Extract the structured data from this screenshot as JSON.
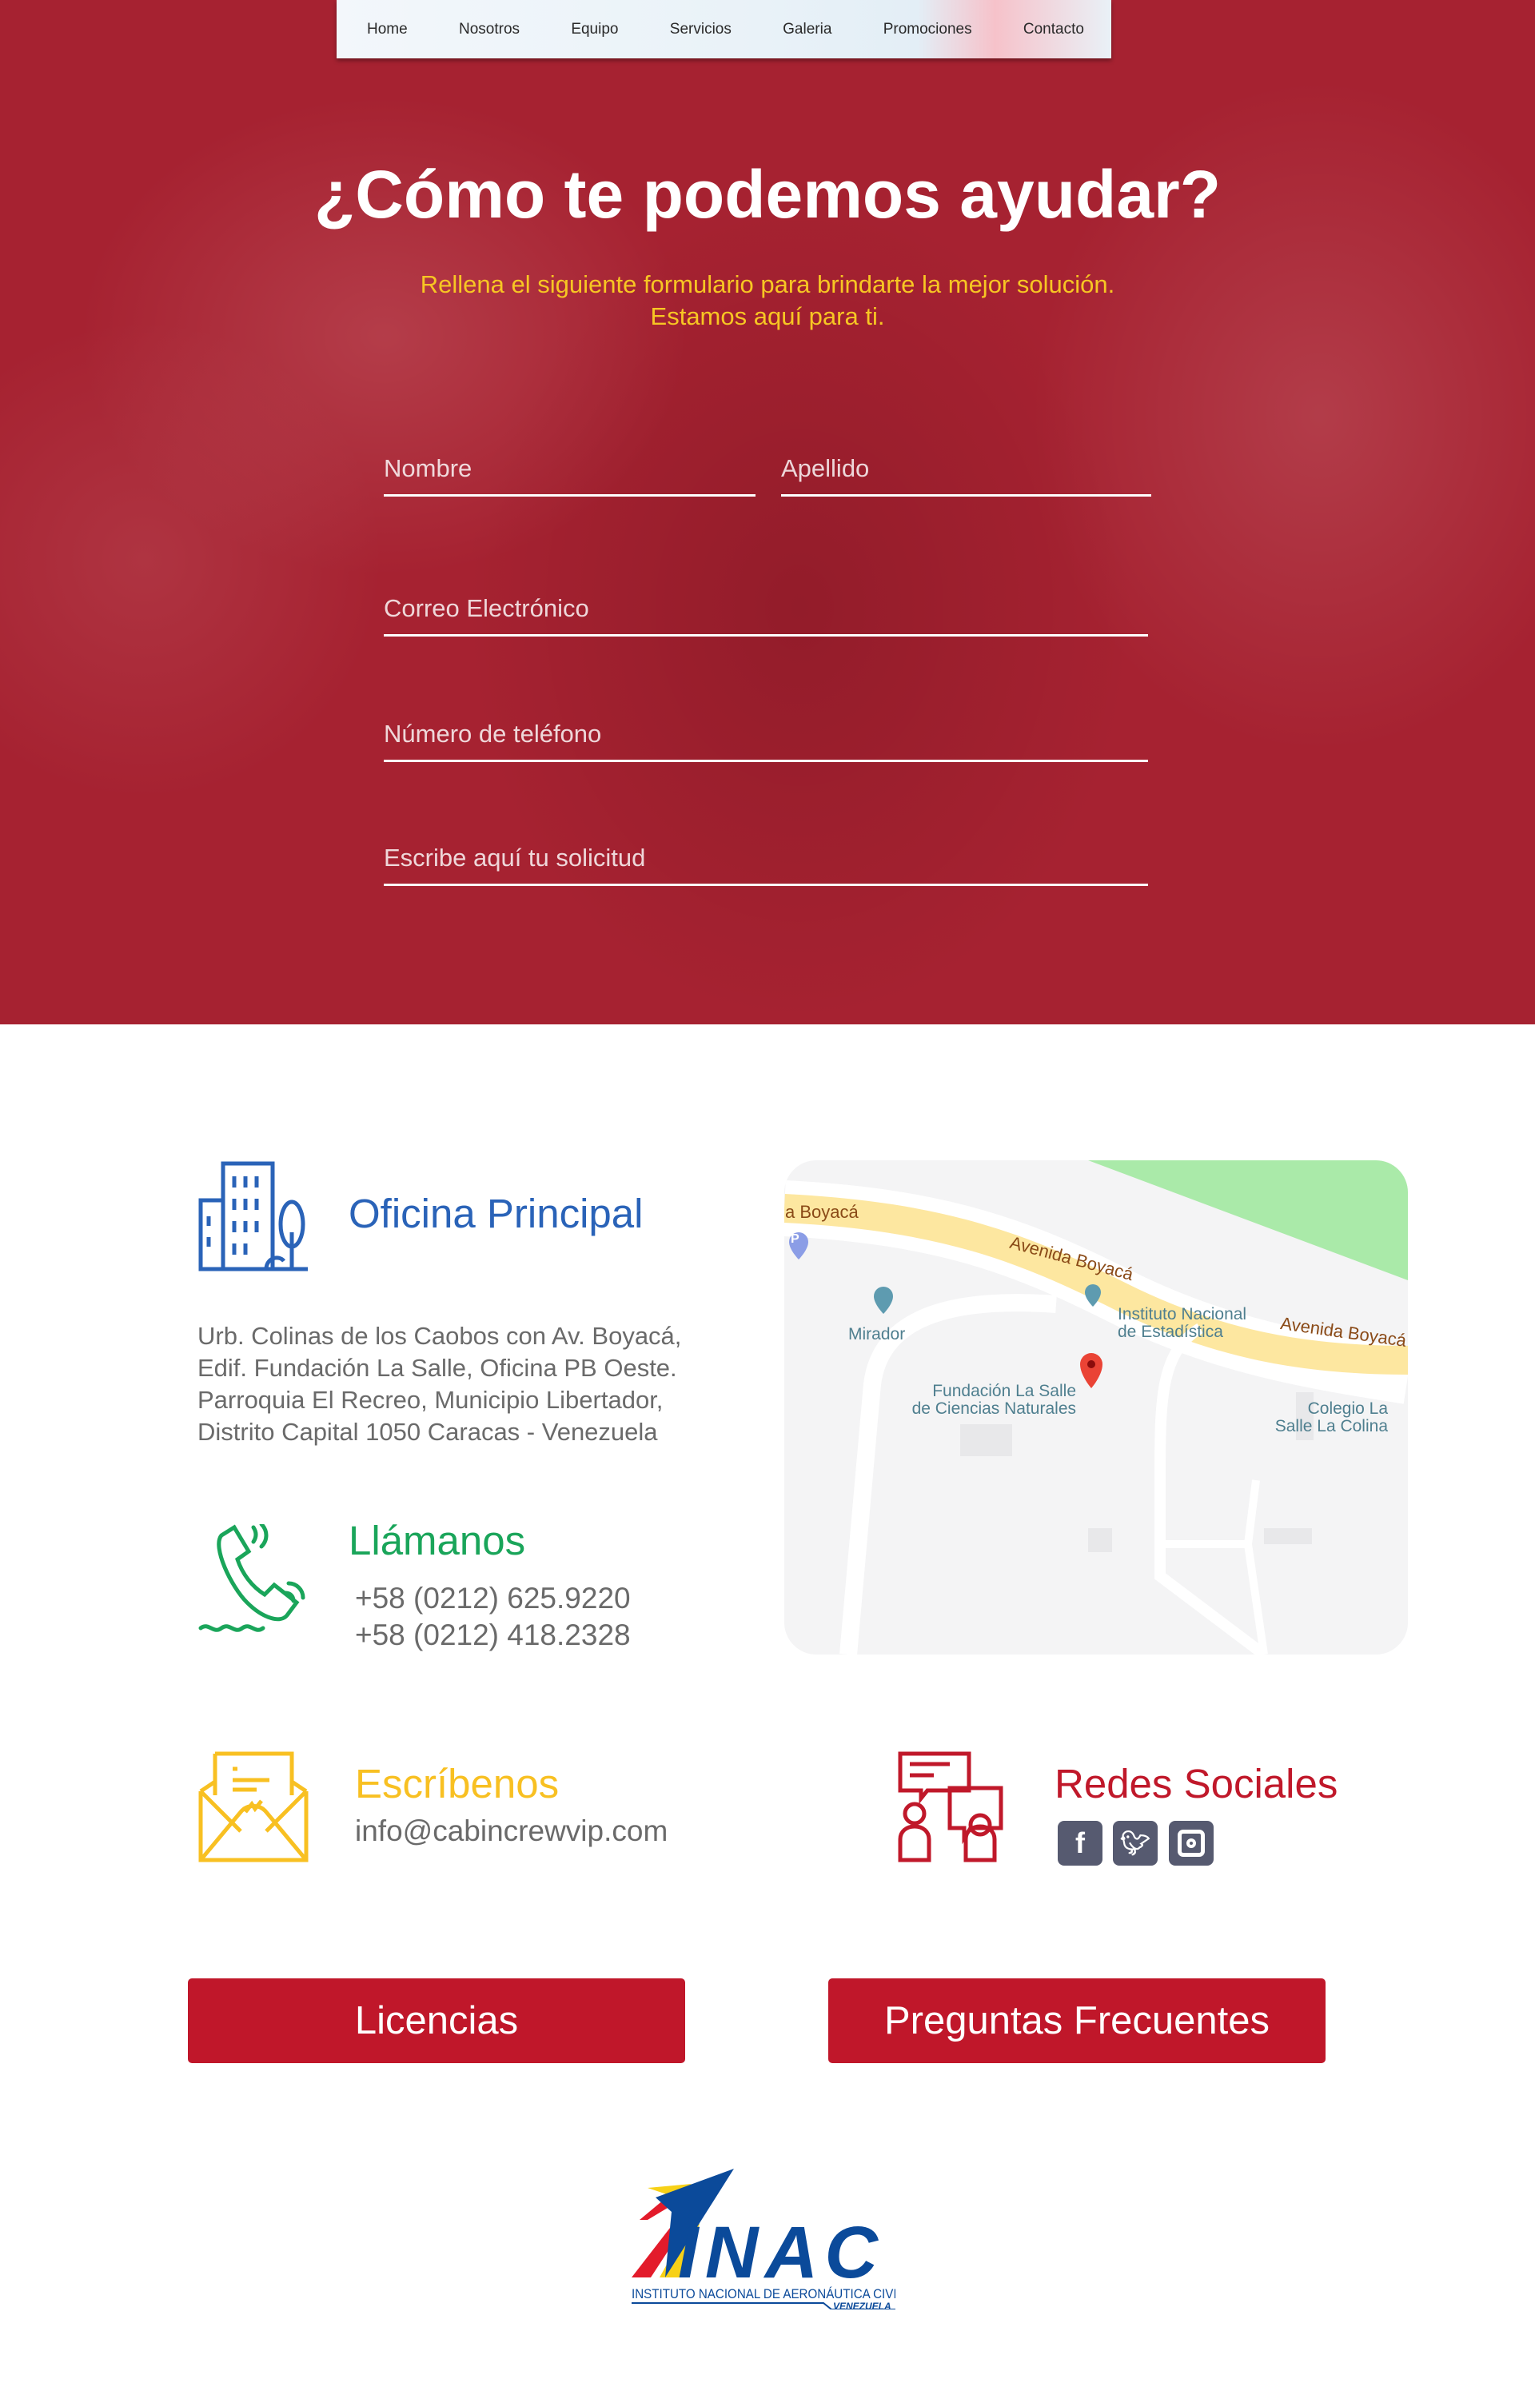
{
  "nav": {
    "items": [
      "Home",
      "Nosotros",
      "Equipo",
      "Servicios",
      "Galeria",
      "Promociones",
      "Contacto"
    ]
  },
  "hero": {
    "title": "¿Cómo te podemos ayudar?",
    "subtitle_1": "Rellena el siguiente formulario para brindarte la mejor solución.",
    "subtitle_2": "Estamos aquí para ti."
  },
  "form": {
    "nombre": "Nombre",
    "apellido": "Apellido",
    "correo": "Correo Electrónico",
    "telefono": "Número de teléfono",
    "solicitud": "Escribe aquí tu solicitud"
  },
  "office": {
    "title": "Oficina Principal",
    "lines": [
      "Urb. Colinas de los Caobos con Av. Boyacá,",
      "Edif. Fundación La Salle, Oficina PB Oeste.",
      "Parroquia El Recreo, Municipio Libertador,",
      "Distrito Capital 1050 Caracas - Venezuela"
    ]
  },
  "call": {
    "title": "Llámanos",
    "phones": [
      "+58 (0212) 625.9220",
      "+58 (0212) 418.2328"
    ]
  },
  "write": {
    "title": "Escríbenos",
    "email": "info@cabincrewvip.com"
  },
  "social": {
    "title": "Redes Sociales",
    "icons": [
      "facebook-icon",
      "twitter-icon",
      "instagram-icon"
    ]
  },
  "map": {
    "labels": {
      "road_1": "a Boyacá",
      "road_2": "Avenida Boyacá",
      "road_3": "Avenida Boyacá",
      "mirador": "Mirador",
      "ine_1": "Instituto Nacional",
      "ine_2": "de Estadística",
      "fls_1": "Fundación La Salle",
      "fls_2": "de Ciencias Naturales",
      "col_1": "Colegio La",
      "col_2": "Salle La Colina",
      "parking": "P"
    }
  },
  "buttons": {
    "licencias": "Licencias",
    "faq": "Preguntas Frecuentes"
  },
  "logo": {
    "text": "INAC",
    "sub": "INSTITUTO NACIONAL DE AERONÁUTICA CIVIL",
    "country": "VENEZUELA"
  },
  "colors": {
    "hero": "#a62231",
    "blue": "#2a63b8",
    "green": "#1aa55a",
    "yellow": "#f8c022",
    "red": "#c0182a"
  }
}
